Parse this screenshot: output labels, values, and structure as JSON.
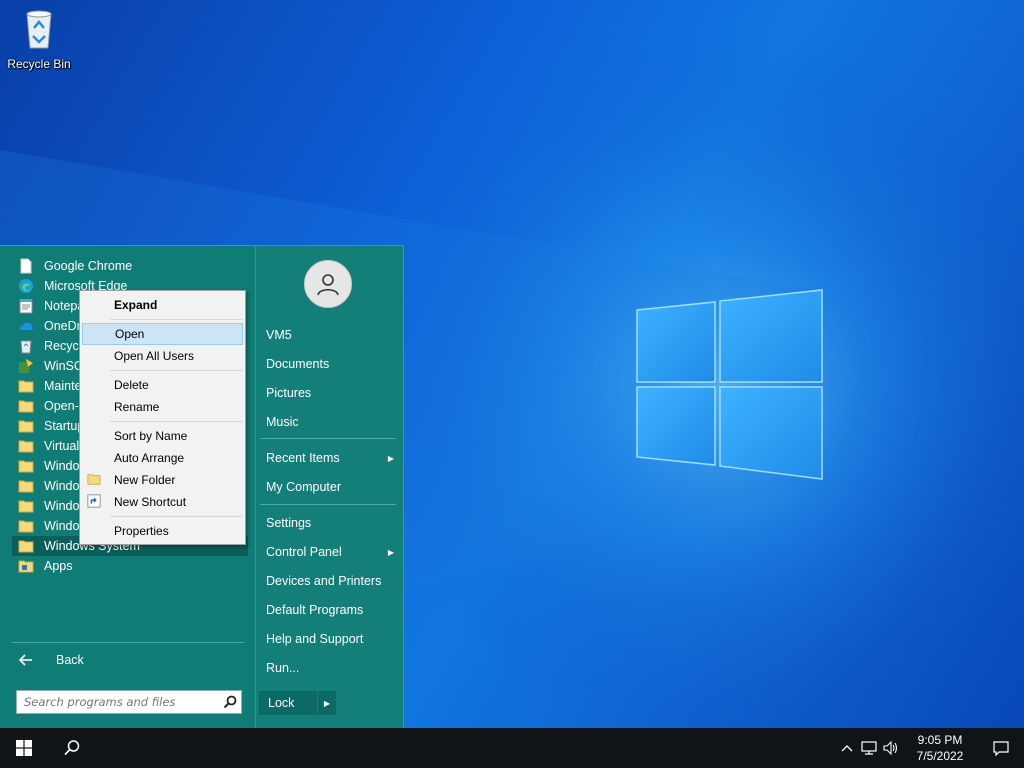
{
  "desktop": {
    "icons": [
      {
        "label": "Recycle Bin",
        "icon": "recycle-bin-icon"
      }
    ]
  },
  "start_menu": {
    "programs": [
      {
        "label": "Google Chrome",
        "icon": "file-icon"
      },
      {
        "label": "Microsoft Edge",
        "icon": "edge-icon"
      },
      {
        "label": "Notepad",
        "icon": "notepad-icon"
      },
      {
        "label": "OneDrive",
        "icon": "onedrive-icon"
      },
      {
        "label": "Recycle Bin",
        "icon": "recycle-bin-icon"
      },
      {
        "label": "WinSCP",
        "icon": "winscp-icon"
      },
      {
        "label": "Maintenance",
        "icon": "folder-icon"
      },
      {
        "label": "Open-Shell",
        "icon": "folder-icon"
      },
      {
        "label": "Startup",
        "icon": "folder-icon"
      },
      {
        "label": "Virtual Apps",
        "icon": "folder-icon"
      },
      {
        "label": "Windows Accessories",
        "icon": "folder-icon"
      },
      {
        "label": "Windows Administrative Tools",
        "icon": "folder-icon"
      },
      {
        "label": "Windows Ease of Access",
        "icon": "folder-icon"
      },
      {
        "label": "Windows PowerShell",
        "icon": "folder-icon"
      },
      {
        "label": "Windows System",
        "icon": "folder-icon",
        "selected": true
      },
      {
        "label": "Apps",
        "icon": "apps-icon"
      }
    ],
    "back_label": "Back",
    "search_placeholder": "Search programs and files",
    "right_items": [
      {
        "label": "VM5",
        "submenu": false
      },
      {
        "label": "Documents",
        "submenu": false
      },
      {
        "label": "Pictures",
        "submenu": false
      },
      {
        "label": "Music",
        "submenu": false
      },
      {
        "label": "Recent Items",
        "submenu": true
      },
      {
        "label": "My Computer",
        "submenu": false
      },
      {
        "label": "Settings",
        "submenu": false
      },
      {
        "label": "Control Panel",
        "submenu": true
      },
      {
        "label": "Devices and Printers",
        "submenu": false
      },
      {
        "label": "Default Programs",
        "submenu": false
      },
      {
        "label": "Help and Support",
        "submenu": false
      },
      {
        "label": "Run...",
        "submenu": false
      }
    ],
    "lock_label": "Lock"
  },
  "context_menu": {
    "groups": [
      [
        {
          "label": "Expand",
          "bold": true
        }
      ],
      [
        {
          "label": "Open",
          "highlighted": true
        },
        {
          "label": "Open All Users"
        }
      ],
      [
        {
          "label": "Delete"
        },
        {
          "label": "Rename"
        }
      ],
      [
        {
          "label": "Sort by Name"
        },
        {
          "label": "Auto Arrange"
        },
        {
          "label": "New Folder",
          "icon": "folder-icon"
        },
        {
          "label": "New Shortcut",
          "icon": "shortcut-icon"
        }
      ],
      [
        {
          "label": "Properties"
        }
      ]
    ]
  },
  "taskbar": {
    "time": "9:05 PM",
    "date": "7/5/2022"
  },
  "colors": {
    "start_menu_bg": "#0f7d76",
    "context_highlight": "#cce4f7",
    "taskbar_bg": "#101417"
  }
}
